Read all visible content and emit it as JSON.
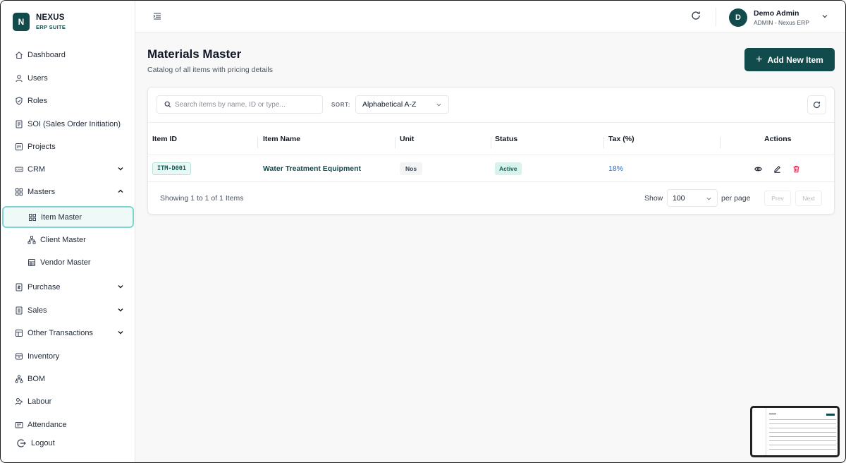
{
  "brand": {
    "logo_letter": "N",
    "name": "NEXUS",
    "subtitle": "ERP SUITE"
  },
  "sidebar": {
    "items": [
      {
        "label": "Dashboard",
        "icon": "home-icon"
      },
      {
        "label": "Users",
        "icon": "user-icon"
      },
      {
        "label": "Roles",
        "icon": "shield-icon"
      },
      {
        "label": "SOI (Sales Order Initiation)",
        "icon": "document-icon"
      },
      {
        "label": "Projects",
        "icon": "projects-icon"
      },
      {
        "label": "CRM",
        "icon": "crm-icon",
        "expandable": true,
        "expanded": false
      },
      {
        "label": "Masters",
        "icon": "grid-icon",
        "expandable": true,
        "expanded": true
      },
      {
        "label": "Item Master",
        "icon": "grid-icon",
        "sub": true,
        "active": true
      },
      {
        "label": "Client Master",
        "icon": "hierarchy-icon",
        "sub": true
      },
      {
        "label": "Vendor Master",
        "icon": "building-icon",
        "sub": true
      },
      {
        "label": "Purchase",
        "icon": "purchase-icon",
        "expandable": true
      },
      {
        "label": "Sales",
        "icon": "sales-icon",
        "expandable": true
      },
      {
        "label": "Other Transactions",
        "icon": "transactions-icon",
        "expandable": true
      },
      {
        "label": "Inventory",
        "icon": "inventory-icon"
      },
      {
        "label": "BOM",
        "icon": "bom-icon"
      },
      {
        "label": "Labour",
        "icon": "labour-icon"
      },
      {
        "label": "Attendance",
        "icon": "attendance-icon"
      }
    ],
    "logout": "Logout"
  },
  "header": {
    "user_initial": "D",
    "user_name": "Demo Admin",
    "user_role": "ADMIN - Nexus ERP"
  },
  "page": {
    "title": "Materials Master",
    "subtitle": "Catalog of all items with pricing details",
    "add_button": "Add New Item"
  },
  "filters": {
    "search_placeholder": "Search items by name, ID or type...",
    "sort_label": "SORT:",
    "sort_value": "Alphabetical A-Z"
  },
  "table": {
    "columns": [
      "Item ID",
      "Item Name",
      "Unit",
      "Status",
      "Tax (%)",
      "Actions"
    ],
    "rows": [
      {
        "id": "ITM-D001",
        "name": "Water Treatment Equipment",
        "unit": "Nos",
        "status": "Active",
        "tax": "18%"
      }
    ]
  },
  "footer": {
    "showing": "Showing 1 to 1 of 1 Items",
    "show_label": "Show",
    "page_size": "100",
    "per_page": "per page",
    "prev": "Prev",
    "next": "Next"
  },
  "colors": {
    "brand": "#124b4b",
    "active_border": "#7fd6cf",
    "tax": "#1d6fd6",
    "delete": "#e11d48"
  }
}
